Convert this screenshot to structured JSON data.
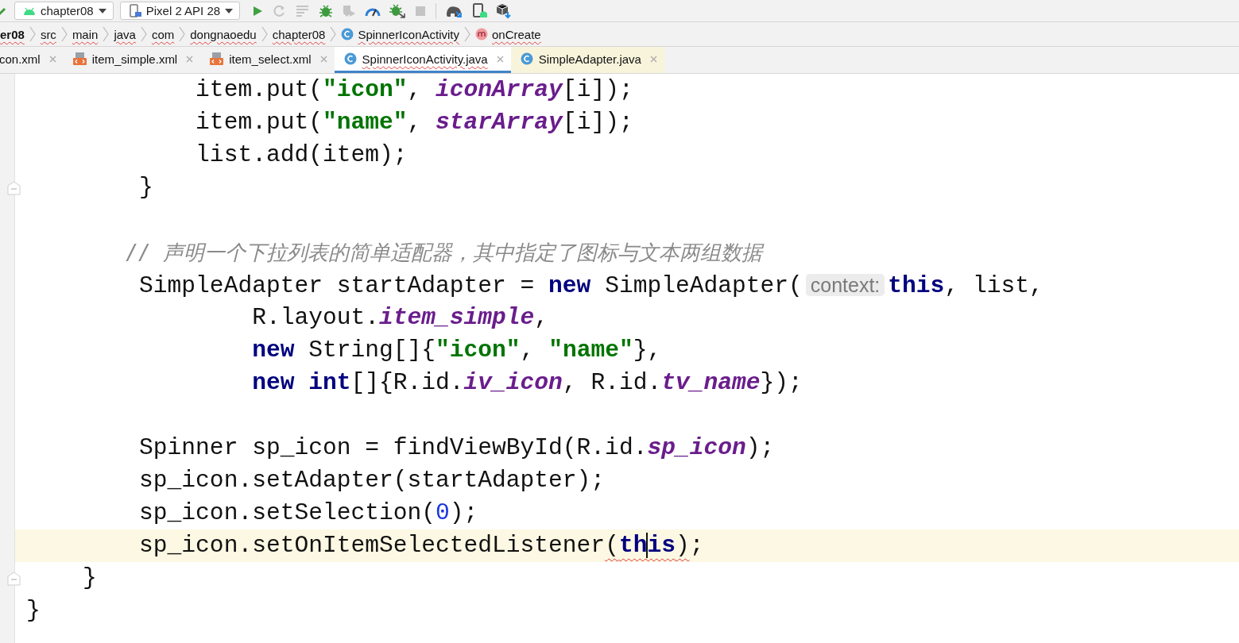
{
  "toolbar": {
    "config": {
      "label": "chapter08"
    },
    "device": {
      "label": "Pixel 2 API 28"
    },
    "actions": [
      {
        "kind": "run",
        "disabled": false
      },
      {
        "kind": "rerun",
        "disabled": true
      },
      {
        "kind": "logs",
        "disabled": true
      },
      {
        "kind": "debug",
        "disabled": false
      },
      {
        "kind": "coverage",
        "disabled": true
      },
      {
        "kind": "profile",
        "disabled": false
      },
      {
        "kind": "attach",
        "disabled": false
      },
      {
        "kind": "stop",
        "disabled": true
      },
      {
        "kind": "sync",
        "disabled": false
      },
      {
        "kind": "avd",
        "disabled": false
      },
      {
        "kind": "sdk",
        "disabled": false
      }
    ]
  },
  "breadcrumbs": [
    {
      "kind": "folder",
      "label": "er08"
    },
    {
      "kind": "folder",
      "label": "src"
    },
    {
      "kind": "folder",
      "label": "main"
    },
    {
      "kind": "folder",
      "label": "java"
    },
    {
      "kind": "folder",
      "label": "com"
    },
    {
      "kind": "folder",
      "label": "dongnaoedu"
    },
    {
      "kind": "folder",
      "label": "chapter08"
    },
    {
      "kind": "class",
      "label": "SpinnerIconActivity"
    },
    {
      "kind": "method",
      "label": "onCreate"
    }
  ],
  "tabs": [
    {
      "kind": "xml",
      "label": "con.xml",
      "selected": false,
      "external": false
    },
    {
      "kind": "layout",
      "label": "item_simple.xml",
      "selected": false,
      "external": false
    },
    {
      "kind": "layout",
      "label": "item_select.xml",
      "selected": false,
      "external": false
    },
    {
      "kind": "class",
      "label": "SpinnerIconActivity.java",
      "selected": true,
      "external": false
    },
    {
      "kind": "class",
      "label": "SimpleAdapter.java",
      "selected": false,
      "external": true
    }
  ],
  "editor": {
    "lines": [
      {
        "fold": false,
        "current": false,
        "tokens": [
          {
            "kind": "plain",
            "text": "            item.put("
          },
          {
            "kind": "string",
            "text": "\"icon\""
          },
          {
            "kind": "plain",
            "text": ", "
          },
          {
            "kind": "field",
            "text": "iconArray"
          },
          {
            "kind": "plain",
            "text": "[i]);"
          }
        ]
      },
      {
        "fold": false,
        "current": false,
        "tokens": [
          {
            "kind": "plain",
            "text": "            item.put("
          },
          {
            "kind": "string",
            "text": "\"name\""
          },
          {
            "kind": "plain",
            "text": ", "
          },
          {
            "kind": "field",
            "text": "starArray"
          },
          {
            "kind": "plain",
            "text": "[i]);"
          }
        ]
      },
      {
        "fold": false,
        "current": false,
        "tokens": [
          {
            "kind": "plain",
            "text": "            list.add(item);"
          }
        ]
      },
      {
        "fold": true,
        "current": false,
        "tokens": [
          {
            "kind": "plain",
            "text": "        }"
          }
        ]
      },
      {
        "fold": false,
        "current": false
      },
      {
        "fold": false,
        "current": false,
        "tokens": [
          {
            "kind": "comment",
            "text": "        // 声明一个下拉列表的简单适配器，其中指定了图标与文本两组数据"
          }
        ]
      },
      {
        "fold": false,
        "current": false,
        "tokens": [
          {
            "kind": "plain",
            "text": "        SimpleAdapter startAdapter = "
          },
          {
            "kind": "keyword",
            "text": "new"
          },
          {
            "kind": "plain",
            "text": " SimpleAdapter("
          },
          {
            "kind": "hint",
            "text": "context:"
          },
          {
            "kind": "keyword",
            "text": "this"
          },
          {
            "kind": "plain",
            "text": ", list,"
          }
        ]
      },
      {
        "fold": false,
        "current": false,
        "tokens": [
          {
            "kind": "plain",
            "text": "                R.layout."
          },
          {
            "kind": "field",
            "text": "item_simple"
          },
          {
            "kind": "plain",
            "text": ","
          }
        ]
      },
      {
        "fold": false,
        "current": false,
        "tokens": [
          {
            "kind": "keyword",
            "text": "                new"
          },
          {
            "kind": "plain",
            "text": " String[]{"
          },
          {
            "kind": "string",
            "text": "\"icon\""
          },
          {
            "kind": "plain",
            "text": ", "
          },
          {
            "kind": "string",
            "text": "\"name\""
          },
          {
            "kind": "plain",
            "text": "},"
          }
        ]
      },
      {
        "fold": false,
        "current": false,
        "tokens": [
          {
            "kind": "keyword",
            "text": "                new int"
          },
          {
            "kind": "plain",
            "text": "[]{R.id."
          },
          {
            "kind": "field",
            "text": "iv_icon"
          },
          {
            "kind": "plain",
            "text": ", R.id."
          },
          {
            "kind": "field",
            "text": "tv_name"
          },
          {
            "kind": "plain",
            "text": "});"
          }
        ]
      },
      {
        "fold": false,
        "current": false
      },
      {
        "fold": false,
        "current": false,
        "tokens": [
          {
            "kind": "plain",
            "text": "        Spinner sp_icon = findViewById(R.id."
          },
          {
            "kind": "field",
            "text": "sp_icon"
          },
          {
            "kind": "plain",
            "text": ");"
          }
        ]
      },
      {
        "fold": false,
        "current": false,
        "tokens": [
          {
            "kind": "plain",
            "text": "        sp_icon.setAdapter(startAdapter);"
          }
        ]
      },
      {
        "fold": false,
        "current": false,
        "tokens": [
          {
            "kind": "plain",
            "text": "        sp_icon.setSelection("
          },
          {
            "kind": "number",
            "text": "0"
          },
          {
            "kind": "plain",
            "text": ");"
          }
        ]
      },
      {
        "fold": false,
        "current": true,
        "tokens": [
          {
            "kind": "plain",
            "text": "        sp_icon.setOnItemSelectedListener"
          },
          {
            "kind": "error",
            "tokens": [
              {
                "kind": "plain",
                "text": "("
              },
              {
                "kind": "keyword",
                "text": "th"
              },
              {
                "kind": "caret"
              },
              {
                "kind": "keyword",
                "text": "is"
              },
              {
                "kind": "plain",
                "text": ")"
              }
            ]
          },
          {
            "kind": "plain",
            "text": ";"
          }
        ]
      },
      {
        "fold": true,
        "current": false,
        "tokens": [
          {
            "kind": "plain",
            "text": "    }"
          }
        ]
      },
      {
        "fold": false,
        "current": false,
        "tokens": [
          {
            "kind": "plain",
            "text": "}"
          }
        ]
      }
    ]
  }
}
